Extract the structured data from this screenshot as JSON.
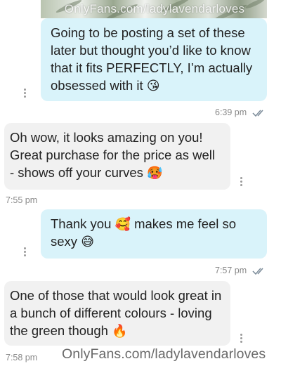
{
  "image_header": {
    "watermark": "OnlyFans.com/ladylavendarloves"
  },
  "messages": [
    {
      "direction": "outgoing",
      "text": "Going to be posting a set of these later but thought you’d like to know that it fits PERFECTLY, I’m actually obsessed with it",
      "emoji": "😘",
      "time": "6:39 pm",
      "status": "read"
    },
    {
      "direction": "incoming",
      "text": "Oh wow, it looks amazing on you! Great purchase for the price as well - shows off your curves",
      "emoji": "🥵",
      "time": "7:55 pm"
    },
    {
      "direction": "outgoing",
      "text_a": "Thank you",
      "emoji_a": "🥰",
      "text_b": "makes me feel so sexy",
      "emoji_b": "😅",
      "time": "7:57 pm",
      "status": "read"
    },
    {
      "direction": "incoming",
      "text": "One of those that would look great in a bunch of different colours - loving the green though",
      "emoji": "🔥",
      "time": "7:58 pm"
    }
  ],
  "footer": {
    "watermark": "OnlyFans.com/ladylavendarloves"
  },
  "colors": {
    "outgoing_bubble": "#d9f3fa",
    "incoming_bubble": "#f1f1f1",
    "meta_text": "#8a8a8a",
    "read_ticks": "#7a8a98"
  },
  "icons": {
    "more": "kebab-menu-icon",
    "read_status": "double-check-icon"
  }
}
